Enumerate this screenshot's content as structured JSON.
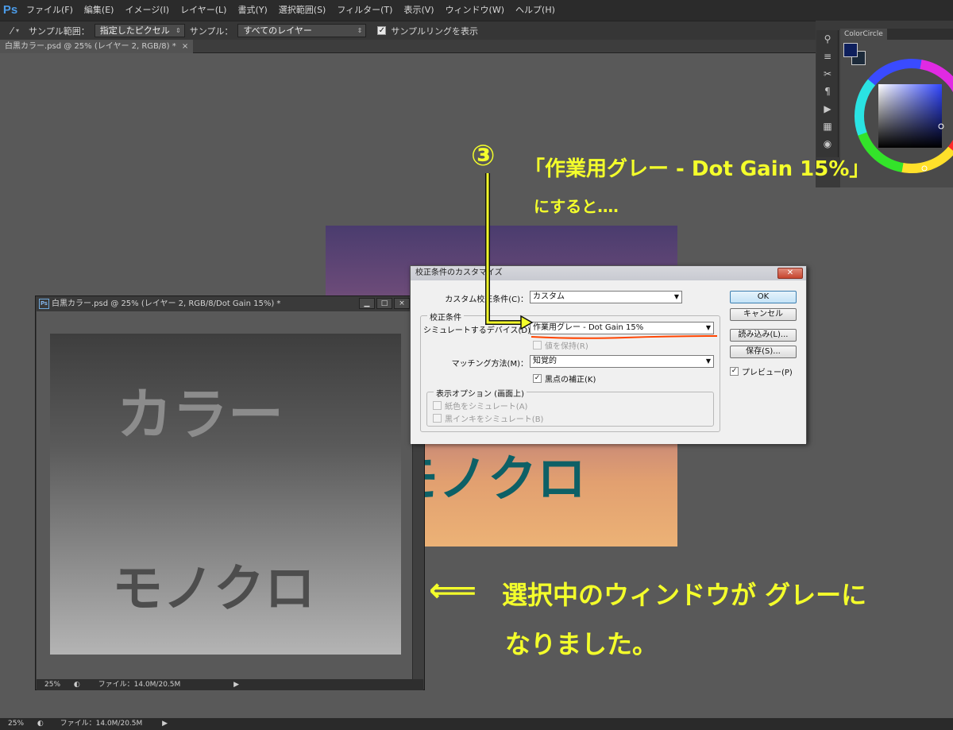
{
  "app": {
    "logo": "Ps"
  },
  "menu": [
    "ファイル(F)",
    "編集(E)",
    "イメージ(I)",
    "レイヤー(L)",
    "書式(Y)",
    "選択範囲(S)",
    "フィルター(T)",
    "表示(V)",
    "ウィンドウ(W)",
    "ヘルプ(H)"
  ],
  "options": {
    "sample_size_label": "サンプル範囲：",
    "sample_size_value": "指定したピクセル",
    "sample_label": "サンプル：",
    "sample_value": "すべてのレイヤー",
    "show_ring_label": "サンプルリングを表示"
  },
  "doc_tab": {
    "title": "白黒カラー.psd @ 25% (レイヤー 2, RGB/8) *",
    "close": "×"
  },
  "colorcircle": {
    "tab": "ColorCircle",
    "fg_color": "#0e1f5c",
    "bg_color": "#1c2a3a"
  },
  "annotations": {
    "step_number": "③",
    "step_text_1": "「作業用グレー - Dot Gain 15%」",
    "step_text_2": "にすると‥‥",
    "arrow": "⟸",
    "result_1": "選択中のウィンドウが グレーに",
    "result_2": "なりました。"
  },
  "canvas_text": {
    "top": "カラー",
    "bottom": "モノクロ"
  },
  "float_window": {
    "ps_icon": "Ps",
    "title": "白黒カラー.psd @ 25% (レイヤー 2, RGB/8/Dot Gain 15%) *",
    "zoom": "25%",
    "file_info": "ファイル：14.0M/20.5M"
  },
  "dialog": {
    "title": "校正条件のカスタマイズ",
    "custom_label": "カスタム校正条件(C)：",
    "custom_value": "カスタム",
    "group_title": "校正条件",
    "device_label": "シミュレートするデバイス(D)：",
    "device_value": "作業用グレー - Dot Gain 15%",
    "preserve_label": "値を保持(R)",
    "matching_label": "マッチング方法(M)：",
    "matching_value": "知覚的",
    "blackpoint_label": "黒点の補正(K)",
    "display_group_title": "表示オプション (画面上)",
    "paper_label": "紙色をシミュレート(A)",
    "ink_label": "黒インキをシミュレート(B)",
    "ok": "OK",
    "cancel": "キャンセル",
    "load": "読み込み(L)...",
    "save": "保存(S)...",
    "preview": "プレビュー(P)"
  },
  "statusbar": {
    "zoom": "25%",
    "file_info": "ファイル：14.0M/20.5M"
  }
}
